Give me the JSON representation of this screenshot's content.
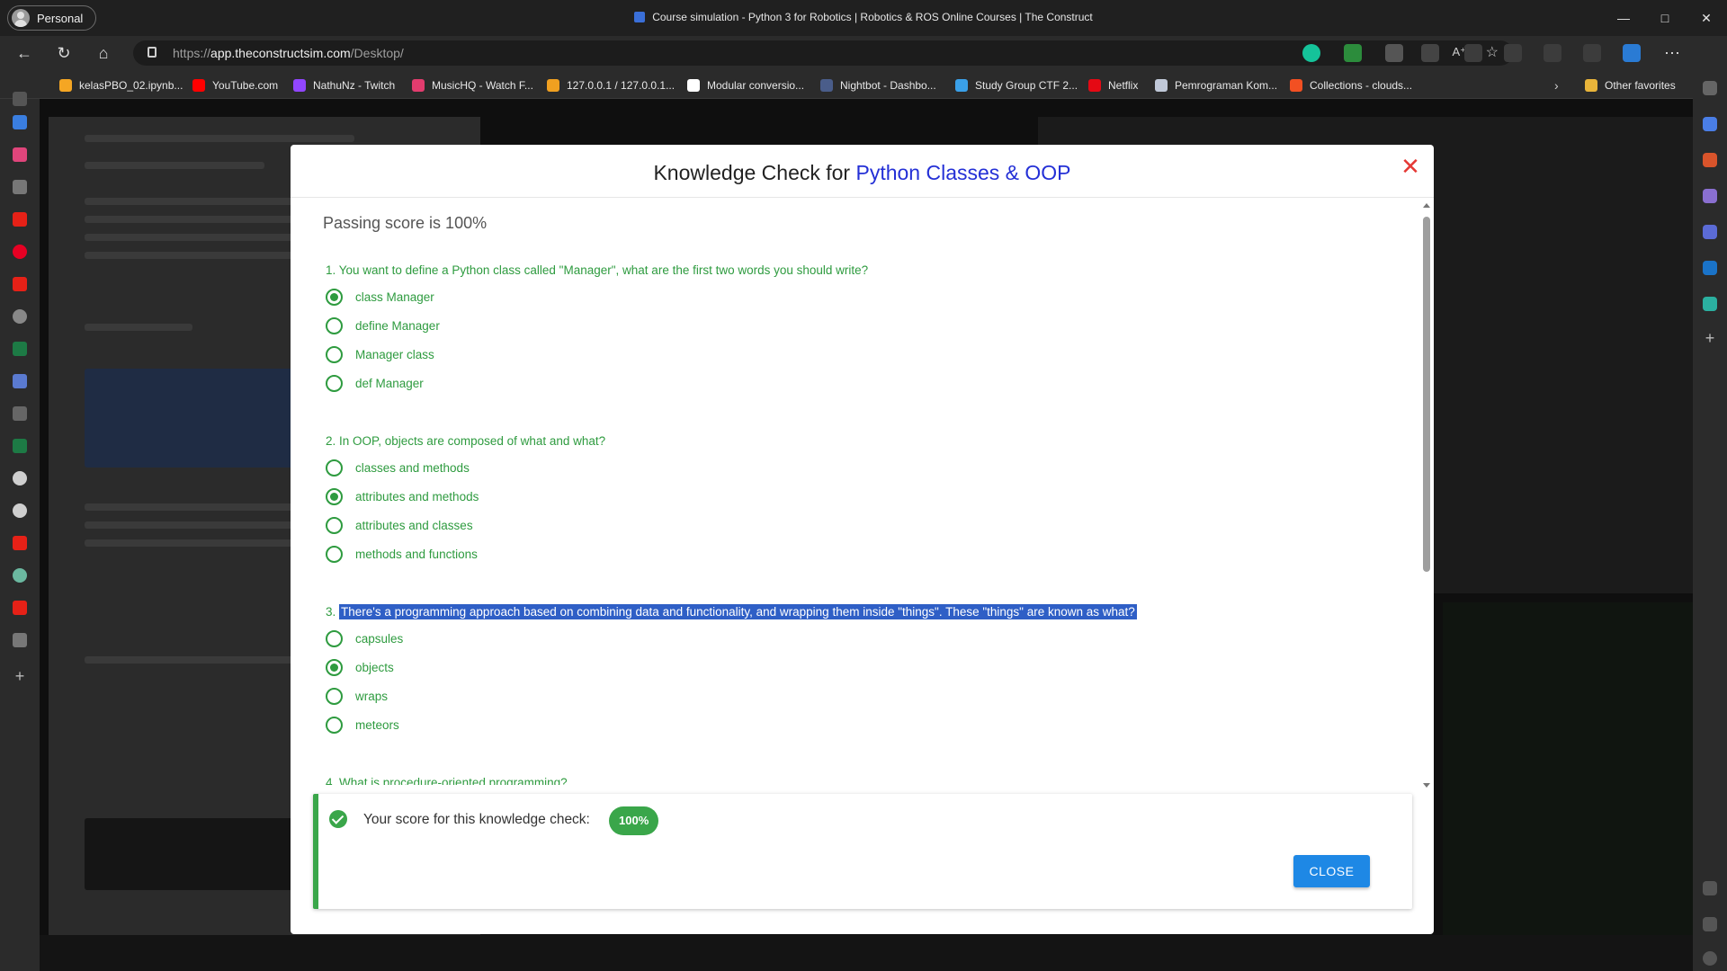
{
  "browser": {
    "profile_label": "Personal",
    "window_title": "Course simulation - Python 3 for Robotics | Robotics & ROS Online Courses | The Construct",
    "url_prefix": "https://",
    "url_host": "app.theconstructsim.com",
    "url_path": "/Desktop/",
    "favorites": [
      {
        "label": "kelasPBO_02.ipynb...",
        "color": "#f5a623"
      },
      {
        "label": "YouTube.com",
        "color": "#ff0000"
      },
      {
        "label": "NathuNz - Twitch",
        "color": "#9146ff"
      },
      {
        "label": "MusicHQ - Watch F...",
        "color": "#e23c6e"
      },
      {
        "label": "127.0.0.1 / 127.0.0.1...",
        "color": "#f0a020"
      },
      {
        "label": "Modular conversio...",
        "color": "#ffffff"
      },
      {
        "label": "Nightbot - Dashbo...",
        "color": "#4a5d8a"
      },
      {
        "label": "Study Group CTF 2...",
        "color": "#3aa0e8"
      },
      {
        "label": "Netflix",
        "color": "#e50914"
      },
      {
        "label": "Pemrograman Kom...",
        "color": "#c0c8d8"
      },
      {
        "label": "Collections - clouds...",
        "color": "#f25022"
      }
    ],
    "other_favorites": "Other favorites"
  },
  "modal": {
    "title_prefix": "Knowledge Check for ",
    "title_topic": "Python Classes & OOP",
    "passing_score": "Passing score is 100%",
    "questions": [
      {
        "text": "1. You want to define a Python class called \"Manager\", what are the first two words you should write?",
        "options": [
          "class Manager",
          "define Manager",
          "Manager class",
          "def Manager"
        ],
        "selected": 0
      },
      {
        "text": "2. In OOP, objects are composed of what and what?",
        "options": [
          "classes and methods",
          "attributes and methods",
          "attributes and classes",
          "methods and functions"
        ],
        "selected": 1
      },
      {
        "text_number": "3.",
        "text": "There's a programming approach based on combining data and functionality, and wrapping them inside \"things\". These \"things\" are known as what?",
        "options": [
          "capsules",
          "objects",
          "wraps",
          "meteors"
        ],
        "selected": 1
      },
      {
        "text": "4. What is procedure-oriented programming?"
      }
    ],
    "result_text": "Your score for this knowledge check:",
    "score_badge": "100%",
    "close_label": "CLOSE"
  }
}
